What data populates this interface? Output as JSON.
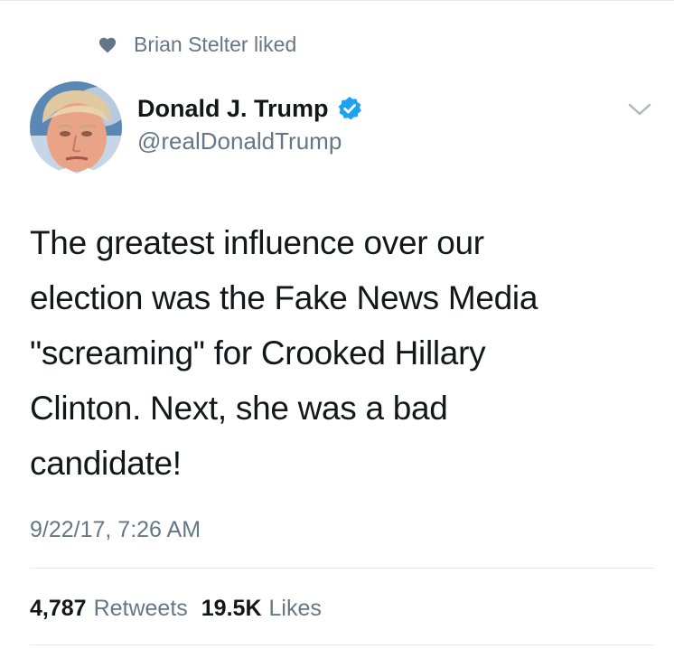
{
  "social_context": {
    "icon": "heart-icon",
    "text": "Brian Stelter liked"
  },
  "author": {
    "avatar": "avatar",
    "display_name": "Donald J. Trump",
    "verified_icon": "verified-badge-icon",
    "handle": "@realDonaldTrump"
  },
  "menu": {
    "icon": "chevron-down-icon"
  },
  "tweet": {
    "text": "The greatest influence over our\nelection was the Fake News Media\n\"screaming\" for Crooked Hillary\nClinton. Next, she was a bad\ncandidate!",
    "timestamp": "9/22/17, 7:26 AM"
  },
  "stats": {
    "retweets_count": "4,787",
    "retweets_label": "Retweets",
    "likes_count": "19.5K",
    "likes_label": "Likes"
  },
  "colors": {
    "text": "#14171a",
    "secondary": "#657786",
    "verified": "#1da1f2",
    "divider": "#e1e8ed"
  }
}
